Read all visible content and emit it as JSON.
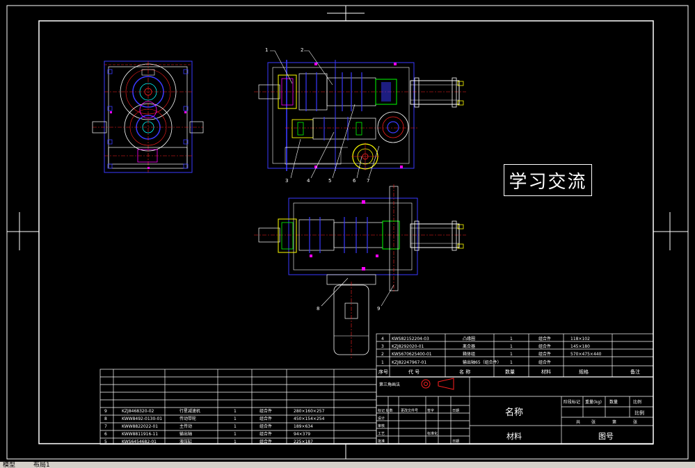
{
  "stamp_text": "学习交流",
  "tabs": [
    "模型",
    "布局1"
  ],
  "colors": {
    "background": "#000000",
    "line": "#ffffff",
    "blue": "#3a3aff",
    "green": "#00ff00",
    "red": "#ff2020",
    "magenta": "#ff00ff",
    "yellow": "#ffff00",
    "cyan": "#00ffff"
  },
  "callouts_top": [
    "1",
    "2",
    "3",
    "4",
    "5",
    "6",
    "7"
  ],
  "callouts_mid": [
    "8",
    "9"
  ],
  "parts_top": {
    "rows": [
      {
        "no": "4",
        "code": "KWS82152204-03",
        "name": "凸缘圈",
        "qty": "1",
        "material": "组合件",
        "spec": "118×102"
      },
      {
        "no": "3",
        "code": "KZJ8292020-01",
        "name": "离合器",
        "qty": "1",
        "material": "组合件",
        "spec": "145×180"
      },
      {
        "no": "2",
        "code": "KWS670625400-01",
        "name": "箱体组",
        "qty": "1",
        "material": "组合件",
        "spec": "570×475×440"
      },
      {
        "no": "1",
        "code": "KZJ82247967-01",
        "name": "输出轴65（组合件）",
        "qty": "1",
        "material": "组合件",
        "spec": ""
      }
    ],
    "header": [
      "序号",
      "代 号",
      "名 称",
      "数量",
      "材料",
      "规格",
      "备注"
    ]
  },
  "parts_left": [
    {
      "no": "9",
      "code": "KZJ8468320-02",
      "name": "行星减速机",
      "qty": "1",
      "material": "组合件",
      "spec": "280×160×257"
    },
    {
      "no": "8",
      "code": "KWW8492-0130-01",
      "name": "传动带轮",
      "qty": "1",
      "material": "组合件",
      "spec": "450×154×254"
    },
    {
      "no": "7",
      "code": "KWW8822022-01",
      "name": "主传动",
      "qty": "1",
      "material": "组合件",
      "spec": "189×634"
    },
    {
      "no": "6",
      "code": "KWW8811916-11",
      "name": "输出轴",
      "qty": "1",
      "material": "组合件",
      "spec": "94×379"
    },
    {
      "no": "5",
      "code": "KWS6454682-01",
      "name": "液压缸",
      "qty": "1",
      "material": "组合件",
      "spec": "225×187"
    }
  ],
  "title_block": {
    "projection": "第三角画法",
    "name_label": "名称",
    "material_label": "材料",
    "drawing_no_label": "图号",
    "scale_label": "比例",
    "stage_labels": [
      "阶段标记",
      "重量(kg)",
      "数量",
      "比例"
    ],
    "sheet_labels": [
      "共",
      "张",
      "第",
      "张"
    ],
    "signature_rows": [
      "标记 处数",
      "设计",
      "审核",
      "工艺",
      "批准"
    ],
    "signature_mid": [
      "更改文件号",
      "签字",
      "日期",
      "标准化",
      "日期"
    ]
  }
}
